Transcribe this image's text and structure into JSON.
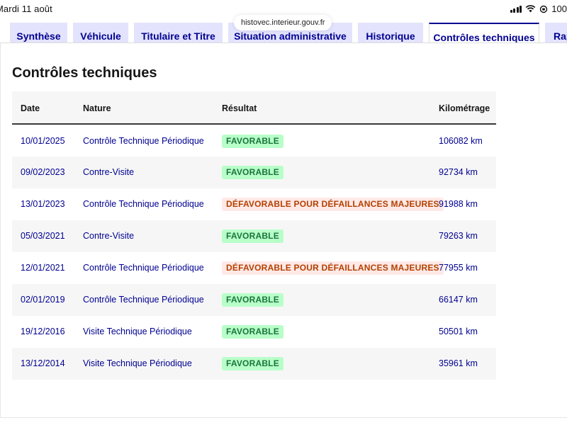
{
  "status_bar": {
    "time": "Mardi 11 août",
    "battery": "100"
  },
  "browser": {
    "url": "histovec.interieur.gouv.fr"
  },
  "tabs": [
    {
      "label": "Synthèse",
      "active": false
    },
    {
      "label": "Véhicule",
      "active": false
    },
    {
      "label": "Titulaire et Titre",
      "active": false
    },
    {
      "label": "Situation administrative",
      "active": false
    },
    {
      "label": "Historique",
      "active": false
    },
    {
      "label": "Contrôles techniques",
      "active": true
    },
    {
      "label": "Rapport",
      "active": false
    }
  ],
  "page": {
    "title": "Contrôles techniques"
  },
  "table": {
    "headers": {
      "date": "Date",
      "nature": "Nature",
      "result": "Résultat",
      "km": "Kilométrage"
    },
    "rows": [
      {
        "date": "10/01/2025",
        "nature": "Contrôle Technique Périodique",
        "result": "FAVORABLE",
        "status": "ok",
        "km": "106082 km"
      },
      {
        "date": "09/02/2023",
        "nature": "Contre-Visite",
        "result": "FAVORABLE",
        "status": "ok",
        "km": "92734 km"
      },
      {
        "date": "13/01/2023",
        "nature": "Contrôle Technique Périodique",
        "result": "DÉFAVORABLE POUR DÉFAILLANCES MAJEURES",
        "status": "ko",
        "km": "91988 km"
      },
      {
        "date": "05/03/2021",
        "nature": "Contre-Visite",
        "result": "FAVORABLE",
        "status": "ok",
        "km": "79263 km"
      },
      {
        "date": "12/01/2021",
        "nature": "Contrôle Technique Périodique",
        "result": "DÉFAVORABLE POUR DÉFAILLANCES MAJEURES",
        "status": "ko",
        "km": "77955 km"
      },
      {
        "date": "02/01/2019",
        "nature": "Contrôle Technique Périodique",
        "result": "FAVORABLE",
        "status": "ok",
        "km": "66147 km"
      },
      {
        "date": "19/12/2016",
        "nature": "Visite Technique Périodique",
        "result": "FAVORABLE",
        "status": "ok",
        "km": "50501 km"
      },
      {
        "date": "13/12/2014",
        "nature": "Visite Technique Périodique",
        "result": "FAVORABLE",
        "status": "ok",
        "km": "35961 km"
      }
    ]
  },
  "colors": {
    "brand_blue": "#000091",
    "favorable_bg": "#b8fec9",
    "favorable_text": "#18753c",
    "defavorable_bg": "#ffe9e6",
    "defavorable_text": "#b34000"
  }
}
